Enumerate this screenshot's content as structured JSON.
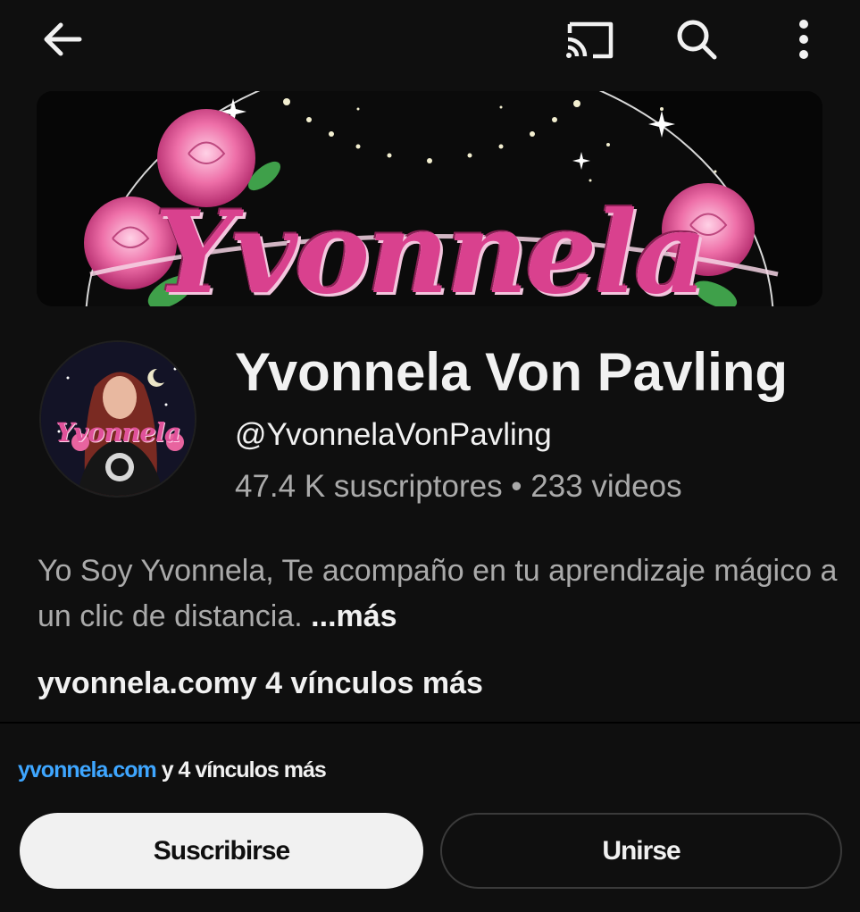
{
  "topbar": {
    "icons": [
      "back-arrow-icon",
      "cast-icon",
      "search-icon",
      "more-vert-icon"
    ]
  },
  "banner": {
    "title": "Yvonnela",
    "colors": {
      "text": "#d9418e",
      "roses": "#e8649f",
      "leaves": "#3fa04a",
      "background": "#060606"
    }
  },
  "avatar": {
    "logo_text": "Yvonnela"
  },
  "channel": {
    "name": "Yvonnela Von Pavling",
    "handle": "@YvonnelaVonPavling",
    "stats": "47.4 K suscriptores • 233 videos"
  },
  "description": {
    "text": "Yo Soy Yvonnela, Te acompaño en tu aprendizaje mágico a un clic de distancia. ",
    "more_label": "...más"
  },
  "links": {
    "url": "yvonnela.com",
    "rest": "y 4 vínculos más"
  },
  "lower": {
    "url": "yvonnela.com",
    "rest": "y 4 vínculos más",
    "subscribe_label": "Suscribirse",
    "join_label": "Unirse"
  },
  "colors": {
    "background": "#0f0f0f",
    "text": "#f1f1f1",
    "secondary_text": "#aaaaaa",
    "link": "#3ea6ff"
  }
}
